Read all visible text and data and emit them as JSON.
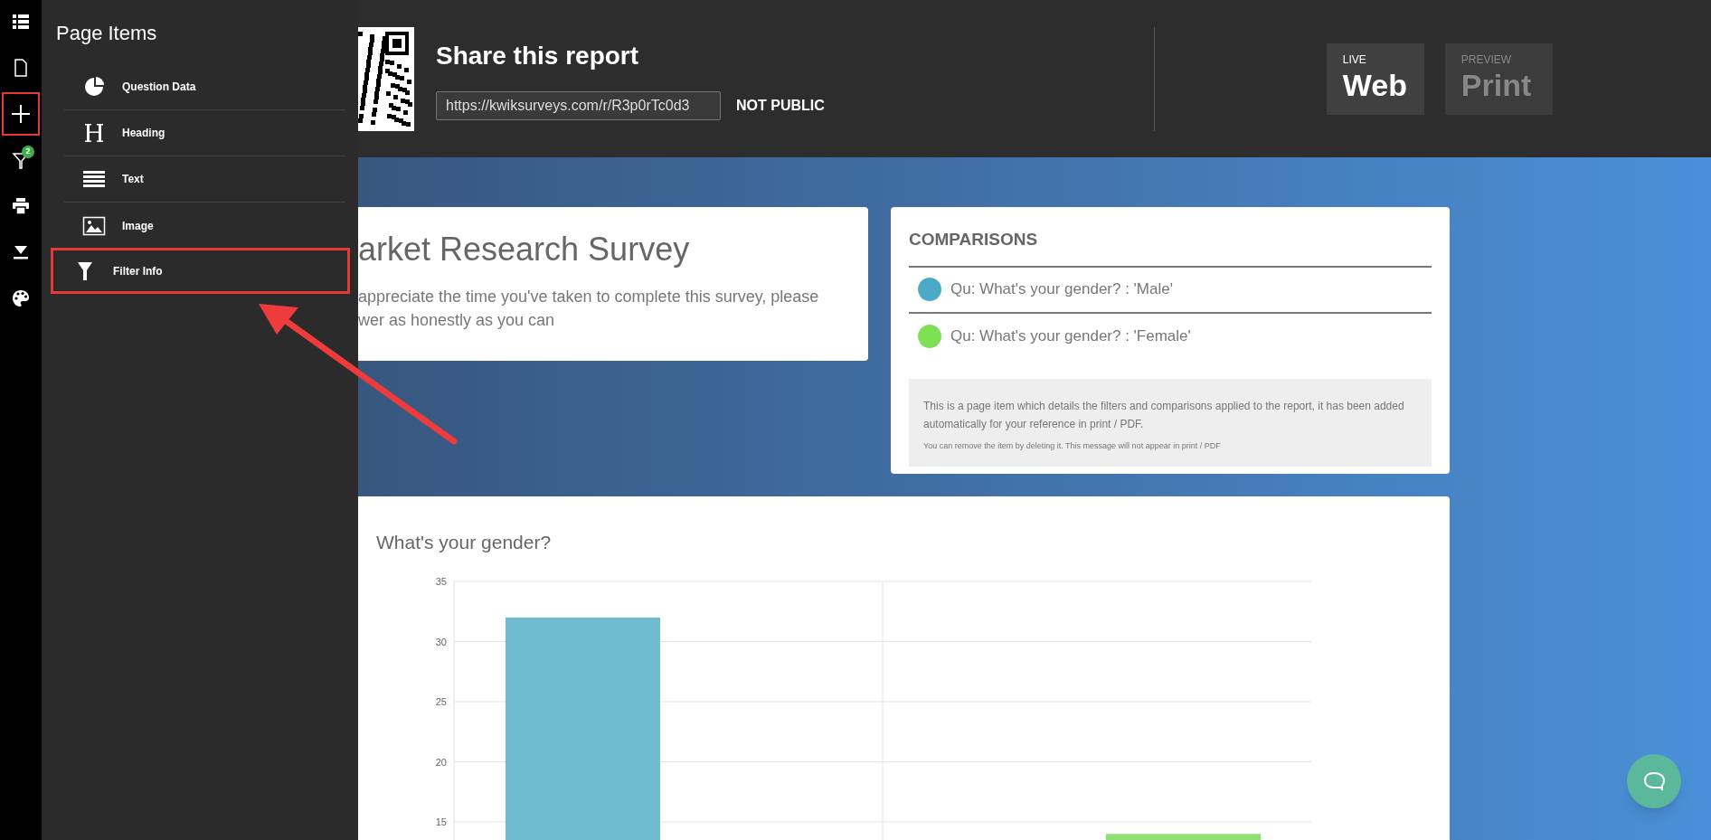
{
  "rail": [
    {
      "selected": false
    },
    {
      "selected": false
    },
    {
      "selected": true
    },
    {
      "selected": false,
      "badge": "2"
    },
    {
      "selected": false
    },
    {
      "selected": false
    },
    {
      "selected": false
    }
  ],
  "panel": {
    "title": "Page Items",
    "items": [
      {
        "kind": "chart",
        "label": "Question Data",
        "selected": false
      },
      {
        "kind": "heading",
        "label": "Heading",
        "selected": false
      },
      {
        "kind": "text",
        "label": "Text",
        "selected": false
      },
      {
        "kind": "image",
        "label": "Image",
        "selected": false
      },
      {
        "kind": "filter",
        "label": "Filter Info",
        "selected": true
      }
    ]
  },
  "share": {
    "title": "Share this report",
    "url": "https://kwiksurveys.com/r/R3p0rTc0d3",
    "visibility": "NOT PUBLIC"
  },
  "modes": [
    {
      "caption": "LIVE",
      "label": "Web",
      "selected": true
    },
    {
      "caption": "PREVIEW",
      "label": "Print",
      "selected": false
    }
  ],
  "intro_card": {
    "title": "arket Research Survey",
    "body": "appreciate the time you've taken to complete this survey, please\nwer as honestly as you can"
  },
  "comparisons": {
    "title": "COMPARISONS",
    "items": [
      {
        "label": "Qu: What's your gender? : 'Male'",
        "color": "#4aaac8"
      },
      {
        "label": "Qu: What's your gender? : 'Female'",
        "color": "#7ee055"
      }
    ],
    "note": "This is a page item which details the filters and comparisons applied to the report, it has been added automatically for your reference in print / PDF.",
    "note_small": "You can remove the item by deleting it. This message will not appear in print / PDF"
  },
  "chart_card": {
    "title": "What's your gender?",
    "chart_data": {
      "type": "bar",
      "grid": true,
      "yticks": [
        15,
        20,
        25,
        30,
        35
      ],
      "ylim": [
        0,
        35
      ],
      "series": [
        {
          "color": "#6fbcd0",
          "values": [
            32,
            null
          ]
        },
        {
          "color": "#8fe072",
          "values": [
            null,
            14
          ]
        }
      ]
    }
  }
}
